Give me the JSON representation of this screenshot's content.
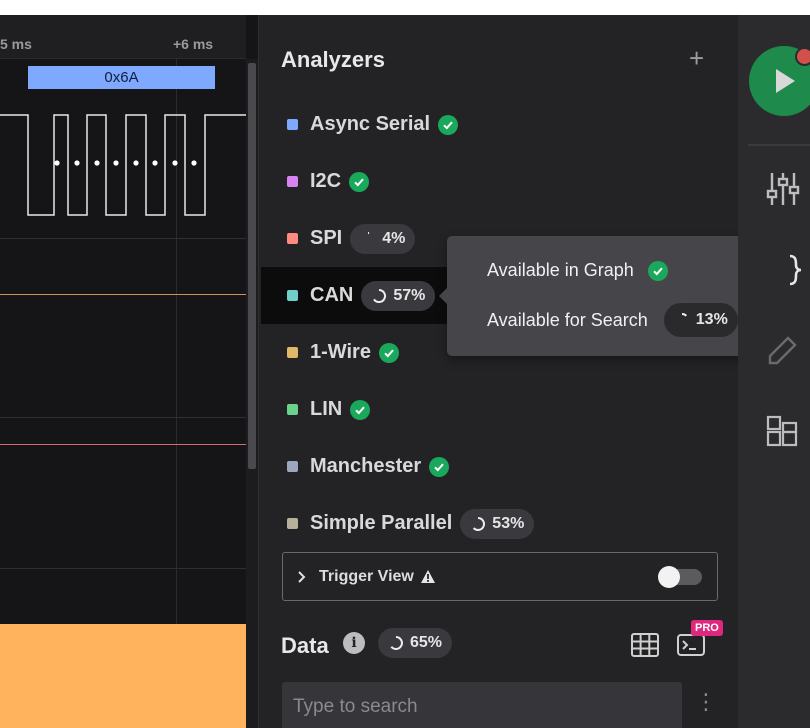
{
  "timeline": {
    "tick_left": "5 ms",
    "tick_right": "+6 ms",
    "protocol_frame_label": "0x6A",
    "colors": {
      "frame": "#7fa9ff",
      "can_line": "#c8965a",
      "spi_line": "#d96a6a",
      "bottom_channel": "#ffb35c"
    }
  },
  "analyzers": {
    "title": "Analyzers",
    "add_icon": "plus-icon",
    "items": [
      {
        "label": "Async Serial",
        "color": "#7fa9ff",
        "status": "complete"
      },
      {
        "label": "I2C",
        "color": "#d884f0",
        "status": "complete"
      },
      {
        "label": "SPI",
        "color": "#ff8a80",
        "status": "progress",
        "percent": "4%"
      },
      {
        "label": "CAN",
        "color": "#6fcfc9",
        "status": "progress",
        "percent": "57%"
      },
      {
        "label": "1-Wire",
        "color": "#e0b86a",
        "status": "complete"
      },
      {
        "label": "LIN",
        "color": "#6ad28a",
        "status": "complete"
      },
      {
        "label": "Manchester",
        "color": "#9ba6bf",
        "status": "complete"
      },
      {
        "label": "Simple Parallel",
        "color": "#b8b09a",
        "status": "progress",
        "percent": "53%"
      }
    ]
  },
  "tooltip": {
    "graph_label": "Available in Graph",
    "search_label": "Available for Search",
    "search_percent": "13%"
  },
  "trigger_view": {
    "label": "Trigger View",
    "warning_icon": "warning-icon",
    "enabled": false
  },
  "data": {
    "title": "Data",
    "info_icon": "info-icon",
    "percent": "65%",
    "pro_badge": "PRO",
    "search_placeholder": "Type to search"
  },
  "rail": {
    "icons": [
      "play-icon",
      "sliders-icon",
      "code-icon",
      "pencil-icon",
      "layout-icon"
    ]
  }
}
